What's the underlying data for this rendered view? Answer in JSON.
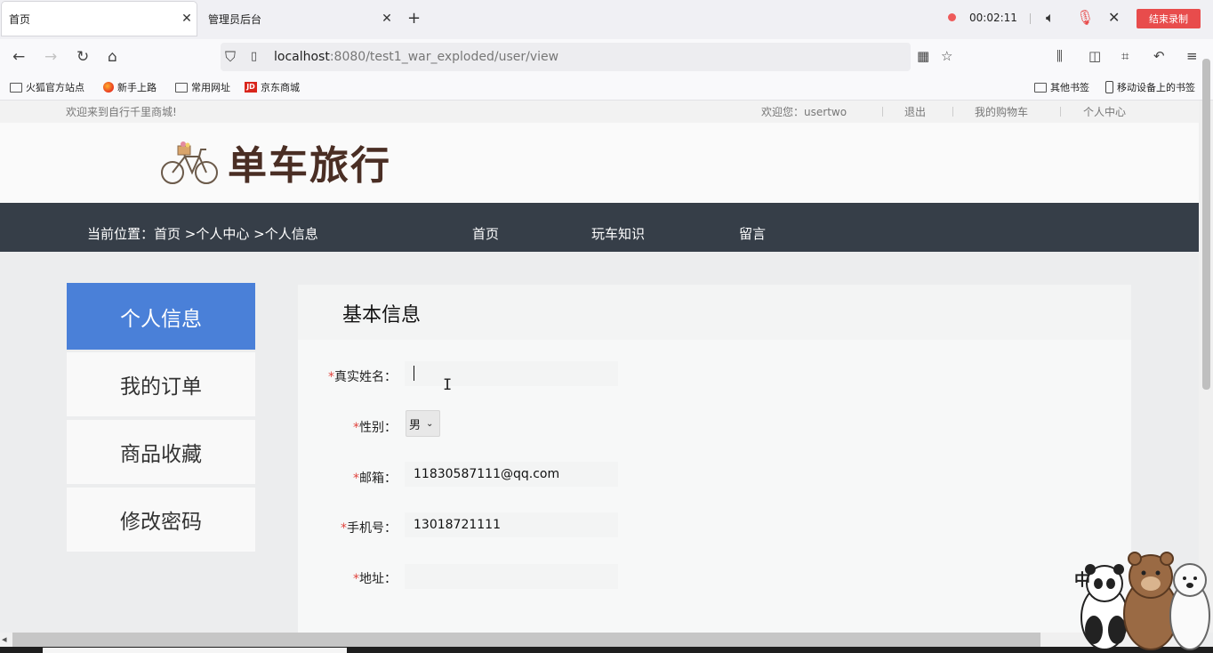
{
  "browser": {
    "tabs": [
      {
        "label": "首页",
        "active": true
      },
      {
        "label": "管理员后台",
        "active": false
      }
    ],
    "new_tab": "+",
    "recording": {
      "time": "00:02:11",
      "stop_label": "结束录制"
    },
    "url": {
      "host": "localhost",
      "rest": ":8080/test1_war_exploded/user/view"
    },
    "bookmarks": [
      "火狐官方站点",
      "新手上路",
      "常用网址",
      "京东商城"
    ],
    "bookmarks_right": [
      "其他书签",
      "移动设备上的书签"
    ],
    "jd_badge": "JD"
  },
  "site": {
    "topbar": {
      "welcome": "欢迎来到自行千里商城!",
      "greeting": "欢迎您：",
      "username": "usertwo",
      "logout": "退出",
      "cart": "我的购物车",
      "personal_center": "个人中心"
    },
    "logo_text": "单车旅行",
    "nav": {
      "breadcrumb_prefix": "当前位置：",
      "breadcrumb": "首页 >个人中心 >个人信息",
      "items": [
        "首页",
        "玩车知识",
        "留言"
      ]
    },
    "sidebar": [
      {
        "label": "个人信息",
        "active": true
      },
      {
        "label": "我的订单",
        "active": false
      },
      {
        "label": "商品收藏",
        "active": false
      },
      {
        "label": "修改密码",
        "active": false
      }
    ],
    "form": {
      "title": "基本信息",
      "required_mark": "*",
      "fields": {
        "real_name": {
          "label": "真实姓名：",
          "value": ""
        },
        "gender": {
          "label": "性别：",
          "value": "男"
        },
        "email": {
          "label": "邮箱：",
          "value": "11830587111@qq.com"
        },
        "phone": {
          "label": "手机号：",
          "value": "13018721111"
        },
        "address": {
          "label": "地址：",
          "value": ""
        }
      }
    }
  },
  "overlay": {
    "ime_char": "中"
  },
  "colors": {
    "accent_blue": "#4a80d8",
    "nav_dark": "#363e48",
    "required_red": "#e0443e",
    "record_red": "#e84c4c"
  }
}
